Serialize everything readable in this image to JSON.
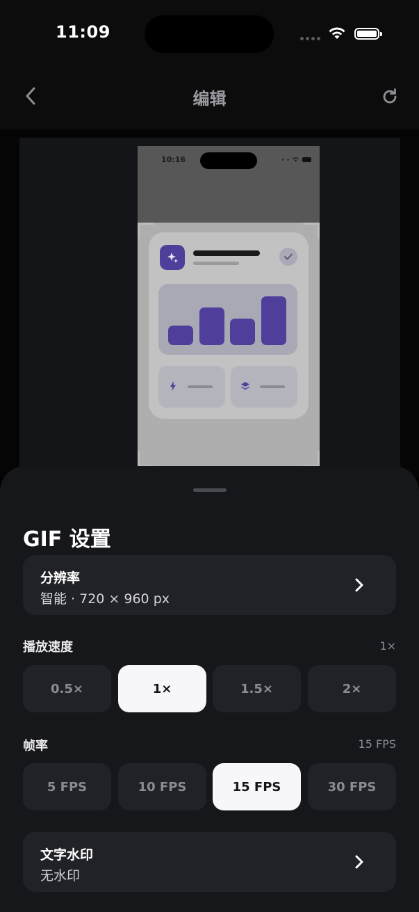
{
  "status_bar": {
    "time": "11:09"
  },
  "nav": {
    "title": "编辑"
  },
  "preview": {
    "phone_time": "10:16"
  },
  "sheet": {
    "title": "GIF 设置",
    "resolution": {
      "label": "分辨率",
      "value": "智能 · 720 × 960 px"
    },
    "speed": {
      "label": "播放速度",
      "current": "1×",
      "options": [
        "0.5×",
        "1×",
        "1.5×",
        "2×"
      ],
      "selected_index": 1
    },
    "framerate": {
      "label": "帧率",
      "current": "15 FPS",
      "options": [
        "5 FPS",
        "10 FPS",
        "15 FPS",
        "30 FPS"
      ],
      "selected_index": 2
    },
    "watermark": {
      "label": "文字水印",
      "value": "无水印"
    }
  },
  "icons": {
    "back": "chevron-left-icon",
    "refresh": "refresh-icon",
    "row_chevron": "chevron-right-icon"
  },
  "colors": {
    "sheet_bg": "#16171b",
    "card_bg": "#212227",
    "active_segment": "#f7f7f9",
    "accent_purple": "#4f3f9a"
  }
}
